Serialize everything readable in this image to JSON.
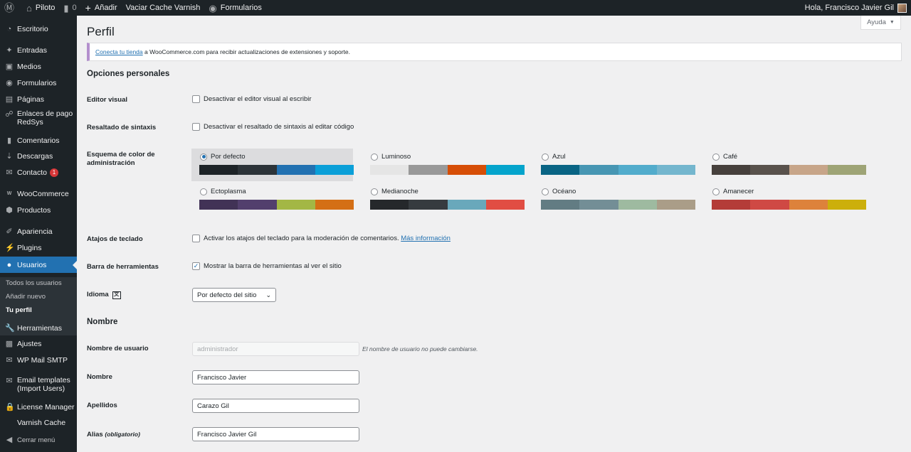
{
  "adminbar": {
    "site_name": "Piloto",
    "comments_count": "0",
    "new_label": "Añadir",
    "varnish_label": "Vaciar Cache Varnish",
    "forms_label": "Formularios",
    "greeting": "Hola, Francisco Javier Gil"
  },
  "sidebar": {
    "items": [
      {
        "label": "Escritorio",
        "icon": "dashboard-icon"
      },
      {
        "label": "Entradas",
        "icon": "pin-icon"
      },
      {
        "label": "Medios",
        "icon": "media-icon"
      },
      {
        "label": "Formularios",
        "icon": "forms-icon"
      },
      {
        "label": "Páginas",
        "icon": "pages-icon"
      },
      {
        "label": "Enlaces de pago RedSys",
        "icon": "link-icon"
      },
      {
        "label": "Comentarios",
        "icon": "comments-icon"
      },
      {
        "label": "Descargas",
        "icon": "download-icon"
      },
      {
        "label": "Contacto",
        "icon": "mail-icon",
        "badge": "1"
      },
      {
        "label": "WooCommerce",
        "icon": "woocommerce-icon"
      },
      {
        "label": "Productos",
        "icon": "products-icon"
      },
      {
        "label": "Apariencia",
        "icon": "brush-icon"
      },
      {
        "label": "Plugins",
        "icon": "plugins-icon"
      },
      {
        "label": "Usuarios",
        "icon": "users-icon"
      },
      {
        "label": "Herramientas",
        "icon": "tools-icon"
      },
      {
        "label": "Ajustes",
        "icon": "settings-icon"
      },
      {
        "label": "WP Mail SMTP",
        "icon": "smtp-icon"
      },
      {
        "label": "Email templates (Import Users)",
        "icon": "email-templates-icon"
      },
      {
        "label": "License Manager",
        "icon": "lock-icon"
      },
      {
        "label": "Varnish Cache",
        "icon": ""
      },
      {
        "label": "Cerrar menú",
        "icon": "collapse-icon"
      }
    ],
    "submenu": [
      "Todos los usuarios",
      "Añadir nuevo",
      "Tu perfil"
    ]
  },
  "page": {
    "help_label": "Ayuda",
    "title": "Perfil",
    "notice_link": "Conecta tu tienda",
    "notice_text": " a WooCommerce.com para recibir actualizaciones de extensiones y soporte."
  },
  "personal": {
    "section_title": "Opciones personales",
    "visual_editor_label": "Editor visual",
    "visual_editor_text": "Desactivar el editor visual al escribir",
    "syntax_label": "Resaltado de sintaxis",
    "syntax_text": "Desactivar el resaltado de sintaxis al editar código",
    "color_scheme_label": "Esquema de color de administración",
    "schemes": [
      {
        "name": "Por defecto",
        "selected": true,
        "colors": [
          "#1d2327",
          "#2c3338",
          "#2271b1",
          "#0a9fd8"
        ]
      },
      {
        "name": "Luminoso",
        "selected": false,
        "colors": [
          "#e5e5e5",
          "#999999",
          "#d64e07",
          "#04a4cc"
        ]
      },
      {
        "name": "Azul",
        "selected": false,
        "colors": [
          "#096484",
          "#4796b3",
          "#52accc",
          "#74b6ce"
        ]
      },
      {
        "name": "Café",
        "selected": false,
        "colors": [
          "#46403c",
          "#59524c",
          "#c7a589",
          "#9ea476"
        ]
      },
      {
        "name": "Ectoplasma",
        "selected": false,
        "colors": [
          "#413256",
          "#523f6d",
          "#a3b745",
          "#d46f15"
        ]
      },
      {
        "name": "Medianoche",
        "selected": false,
        "colors": [
          "#25282b",
          "#363b3f",
          "#69a8bb",
          "#e14d43"
        ]
      },
      {
        "name": "Océano",
        "selected": false,
        "colors": [
          "#627c83",
          "#738e96",
          "#9ebaa0",
          "#aa9d88"
        ]
      },
      {
        "name": "Amanecer",
        "selected": false,
        "colors": [
          "#b43c38",
          "#cf4944",
          "#dd823b",
          "#ccaf0b"
        ]
      }
    ],
    "shortcuts_label": "Atajos de teclado",
    "shortcuts_text": "Activar los atajos del teclado para la moderación de comentarios.",
    "shortcuts_link": "Más información",
    "toolbar_label": "Barra de herramientas",
    "toolbar_text": "Mostrar la barra de herramientas al ver el sitio",
    "language_label": "Idioma",
    "language_value": "Por defecto del sitio"
  },
  "name_section": {
    "section_title": "Nombre",
    "username_label": "Nombre de usuario",
    "username_value": "administrador",
    "username_desc": "El nombre de usuario no puede cambiarse.",
    "first_name_label": "Nombre",
    "first_name_value": "Francisco Javier",
    "last_name_label": "Apellidos",
    "last_name_value": "Carazo Gil",
    "nickname_label": "Alias",
    "nickname_required": "(obligatorio)",
    "nickname_value": "Francisco Javier Gil"
  }
}
